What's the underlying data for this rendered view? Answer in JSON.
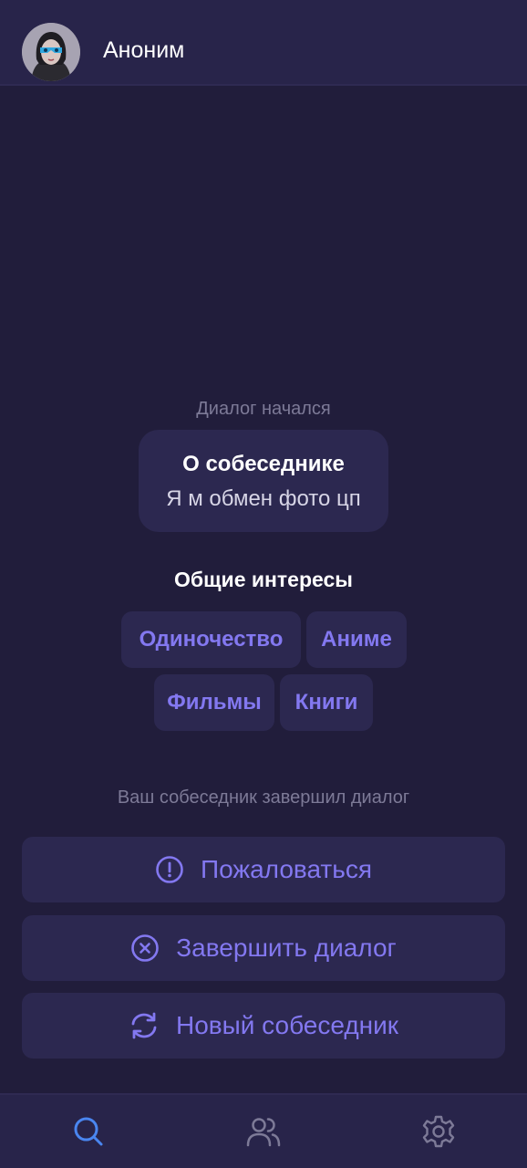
{
  "header": {
    "title": "Аноним",
    "avatar_icon": "masked-user-avatar"
  },
  "chat": {
    "dialog_started": "Диалог начался",
    "about": {
      "title": "О собеседнике",
      "text": "Я м обмен фото цп"
    },
    "interests": {
      "title": "Общие интересы",
      "items": [
        "Одиночество",
        "Аниме",
        "Фильмы",
        "Книги"
      ]
    },
    "ended_notice": "Ваш собеседник завершил диалог"
  },
  "actions": {
    "report": {
      "label": "Пожаловаться",
      "icon": "exclamation-circle-icon"
    },
    "end": {
      "label": "Завершить диалог",
      "icon": "close-circle-icon"
    },
    "new": {
      "label": "Новый собеседник",
      "icon": "refresh-icon"
    }
  },
  "bottom_nav": {
    "items": [
      {
        "icon": "search-icon",
        "active": true
      },
      {
        "icon": "users-icon",
        "active": false
      },
      {
        "icon": "gear-icon",
        "active": false
      }
    ]
  },
  "colors": {
    "background": "#211d3b",
    "header": "#28244a",
    "card": "#2c2850",
    "accent": "#8378f0",
    "active_nav": "#4a86f0",
    "muted_text": "#7d7a97"
  }
}
